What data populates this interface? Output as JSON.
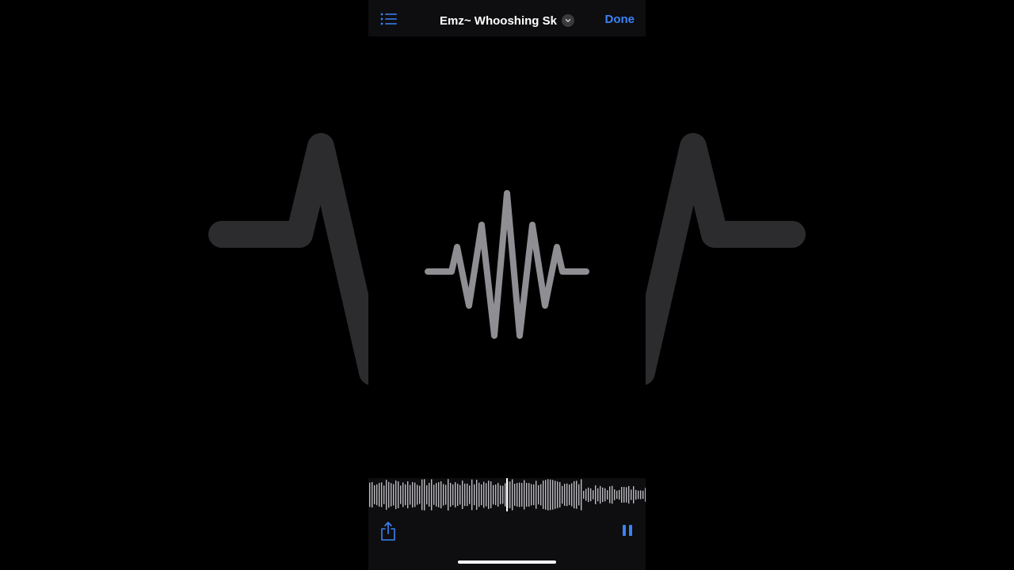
{
  "header": {
    "title": "Emz~ Whooshing Sk",
    "done_label": "Done"
  },
  "icons": {
    "menu": "list-icon",
    "title_menu": "chevron-down-icon",
    "share": "share-icon",
    "pause": "pause-icon",
    "artwork": "waveform-icon"
  },
  "colors": {
    "accent": "#3b82f6",
    "background": "#000000",
    "bar_background": "#0e0e10",
    "waveform": "#8e8e93",
    "scrubber_bars": "#bdbdc2"
  }
}
